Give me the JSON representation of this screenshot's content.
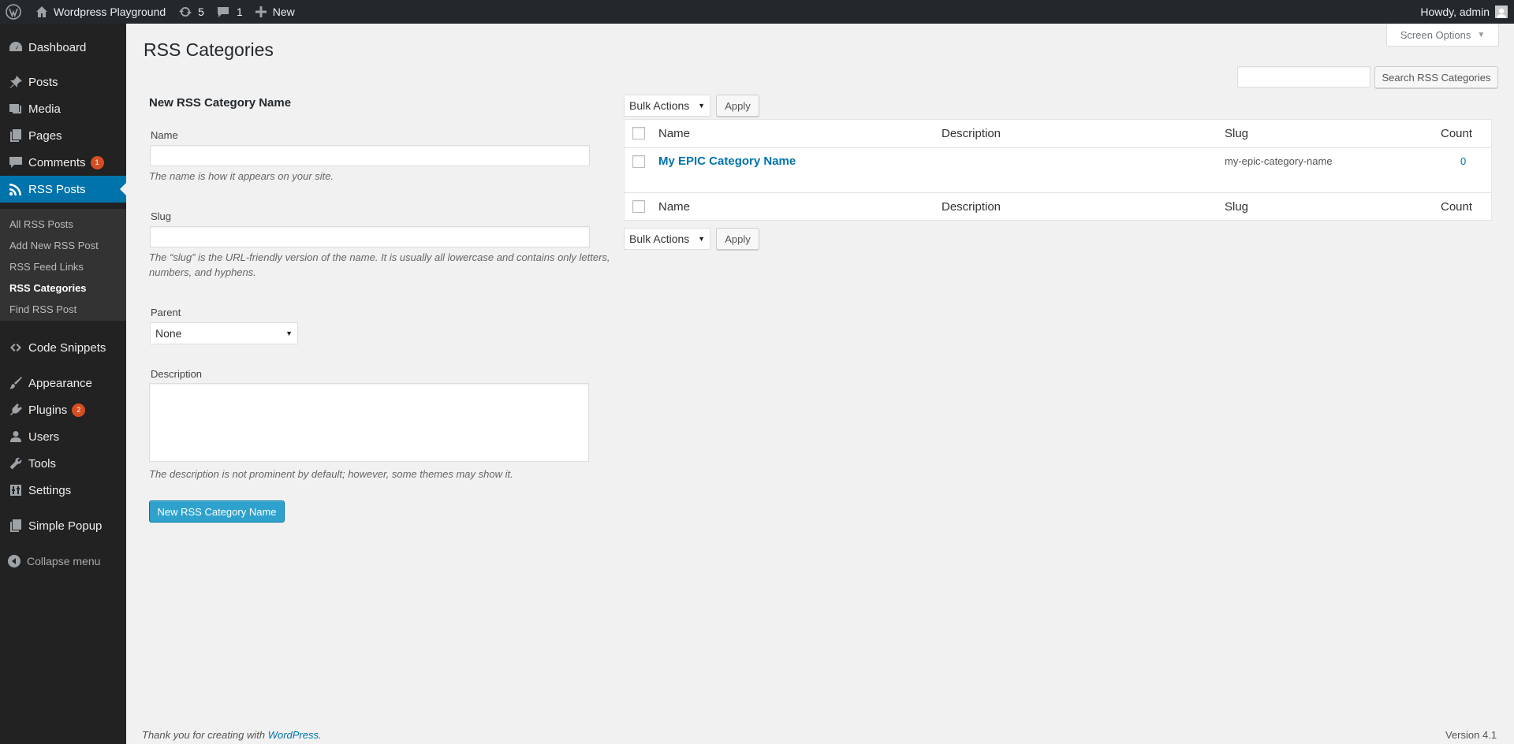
{
  "admin_bar": {
    "site_name": "Wordpress Playground",
    "updates_count": "5",
    "comments_count": "1",
    "new_label": "New",
    "greeting": "Howdy, admin"
  },
  "sidebar": {
    "items": [
      {
        "label": "Dashboard",
        "icon": "dashboard-icon"
      },
      {
        "label": "Posts",
        "icon": "pin-icon"
      },
      {
        "label": "Media",
        "icon": "media-icon"
      },
      {
        "label": "Pages",
        "icon": "pages-icon"
      },
      {
        "label": "Comments",
        "icon": "comment-icon",
        "badge": "1"
      },
      {
        "label": "RSS Posts",
        "icon": "rss-icon"
      },
      {
        "label": "Code Snippets",
        "icon": "code-icon"
      },
      {
        "label": "Appearance",
        "icon": "brush-icon"
      },
      {
        "label": "Plugins",
        "icon": "plugin-icon",
        "badge": "2"
      },
      {
        "label": "Users",
        "icon": "user-icon"
      },
      {
        "label": "Tools",
        "icon": "wrench-icon"
      },
      {
        "label": "Settings",
        "icon": "settings-icon"
      },
      {
        "label": "Simple Popup",
        "icon": "popup-icon"
      }
    ],
    "submenu": [
      "All RSS Posts",
      "Add New RSS Post",
      "RSS Feed Links",
      "RSS Categories",
      "Find RSS Post"
    ],
    "collapse_label": "Collapse menu"
  },
  "page": {
    "title": "RSS Categories",
    "screen_options": "Screen Options",
    "search_button": "Search RSS Categories"
  },
  "form": {
    "heading": "New RSS Category Name",
    "name_label": "Name",
    "name_hint": "The name is how it appears on your site.",
    "slug_label": "Slug",
    "slug_hint_1": "The “slug” is the URL-friendly version of the name. It is usually all lowercase and contains only letters,",
    "slug_hint_2": "numbers, and hyphens.",
    "parent_label": "Parent",
    "parent_value": "None",
    "description_label": "Description",
    "description_hint": "The description is not prominent by default; however, some themes may show it.",
    "submit_label": "New RSS Category Name"
  },
  "table": {
    "bulk_actions": "Bulk Actions",
    "apply": "Apply",
    "columns": [
      "Name",
      "Description",
      "Slug",
      "Count"
    ],
    "rows": [
      {
        "name": "My EPIC Category Name",
        "description": "",
        "slug": "my-epic-category-name",
        "count": "0"
      }
    ]
  },
  "footer": {
    "thanks_prefix": "Thank you for creating with ",
    "thanks_link": "WordPress",
    "thanks_suffix": ".",
    "version": "Version 4.1"
  },
  "colors": {
    "admin_bar": "#23282d",
    "sidebar": "#222222",
    "accent": "#0073aa",
    "primary_button": "#2ea2cc",
    "badge": "#d54e21"
  }
}
